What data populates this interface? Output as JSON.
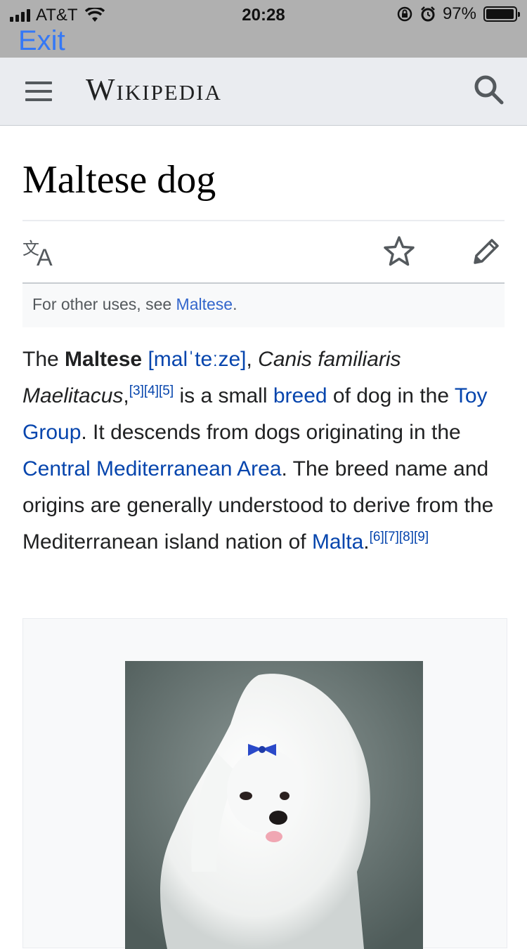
{
  "status_bar": {
    "carrier": "AT&T",
    "time": "20:28",
    "battery_percent": "97%",
    "battery_level": 0.97,
    "signal_bars": 4
  },
  "exit_label": "Exit",
  "header": {
    "wordmark": "Wikipedia",
    "icons": [
      "menu-icon",
      "search-icon"
    ]
  },
  "article": {
    "title": "Maltese dog",
    "action_icons": [
      "language-icon",
      "star-icon",
      "edit-icon"
    ],
    "hatnote": {
      "prefix": "For other uses, see ",
      "link": "Maltese",
      "suffix": "."
    },
    "intro": {
      "t1": "The ",
      "bold": "Maltese",
      "t2": " ",
      "ipa": "[malˈteːze]",
      "t3": ", ",
      "italic": "Canis familiaris Maelitacus",
      "t4": ",",
      "refs1": "[3][4][5]",
      "t5": " is a small ",
      "link_breed": "breed",
      "t6": " of dog in the ",
      "link_toy": "Toy Group",
      "t7": ". It descends from dogs originating in the ",
      "link_area": "Central Mediterranean Area",
      "t8": ". The breed name and origins are generally understood to derive from the Mediterranean island nation of ",
      "link_malta": "Malta",
      "t9": ".",
      "refs2": "[6][7][8][9]"
    }
  },
  "colors": {
    "link": "#0645ad",
    "ios_blue": "#3478f6",
    "header_bg": "#eaecf0"
  }
}
